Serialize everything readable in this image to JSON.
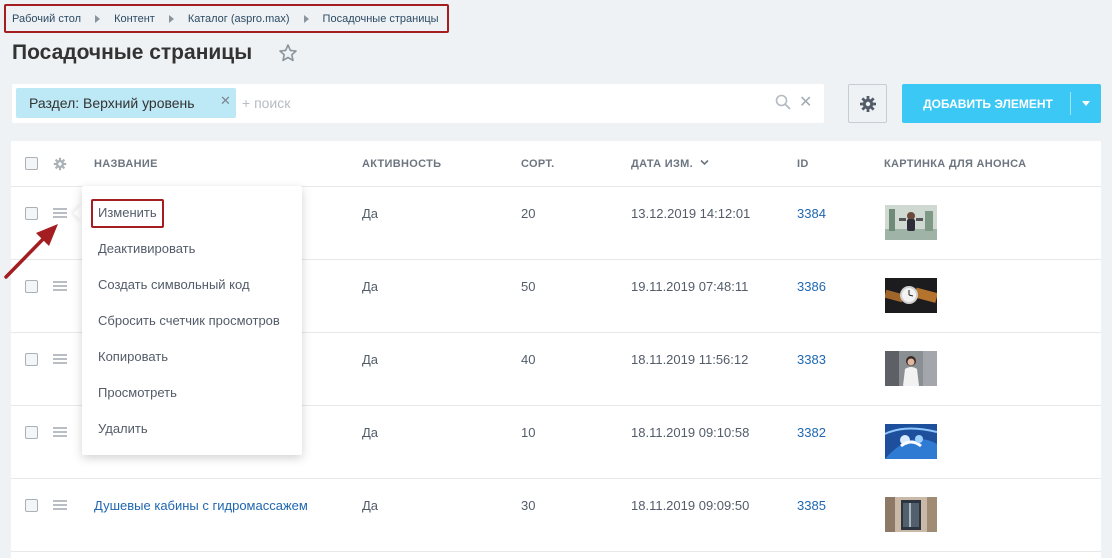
{
  "breadcrumb": [
    "Рабочий стол",
    "Контент",
    "Каталог (aspro.max)",
    "Посадочные страницы"
  ],
  "page_title": "Посадочные страницы",
  "filter": {
    "chip": "Раздел: Верхний уровень",
    "placeholder": "+ поиск"
  },
  "toolbar": {
    "add_label": "ДОБАВИТЬ ЭЛЕМЕНТ"
  },
  "table": {
    "columns": {
      "name": "НАЗВАНИЕ",
      "active": "АКТИВНОСТЬ",
      "sort": "СОРТ.",
      "date": "ДАТА ИЗМ.",
      "id": "ID",
      "image": "КАРТИНКА ДЛЯ АНОНСА"
    },
    "rows": [
      {
        "name": "",
        "active": "Да",
        "sort": "20",
        "date": "13.12.2019 14:12:01",
        "id": "3384",
        "image": "fitness-photo"
      },
      {
        "name": "",
        "active": "Да",
        "sort": "50",
        "date": "19.11.2019 07:48:11",
        "id": "3386",
        "image": "watch-photo"
      },
      {
        "name": "",
        "active": "Да",
        "sort": "40",
        "date": "18.11.2019 11:56:12",
        "id": "3383",
        "image": "girl-photo"
      },
      {
        "name": "",
        "active": "Да",
        "sort": "10",
        "date": "18.11.2019 09:10:58",
        "id": "3382",
        "image": "handshake-photo"
      },
      {
        "name": "Душевые кабины с гидромассажем",
        "active": "Да",
        "sort": "30",
        "date": "18.11.2019 09:09:50",
        "id": "3385",
        "image": "shower-photo"
      }
    ]
  },
  "context_menu": [
    "Изменить",
    "Деактивировать",
    "Создать символьный код",
    "Сбросить счетчик просмотров",
    "Копировать",
    "Просмотреть",
    "Удалить"
  ],
  "colors": {
    "accent": "#3bc8f5",
    "link": "#2067b0",
    "highlight": "#a31d21",
    "chip": "#bde8f5"
  }
}
